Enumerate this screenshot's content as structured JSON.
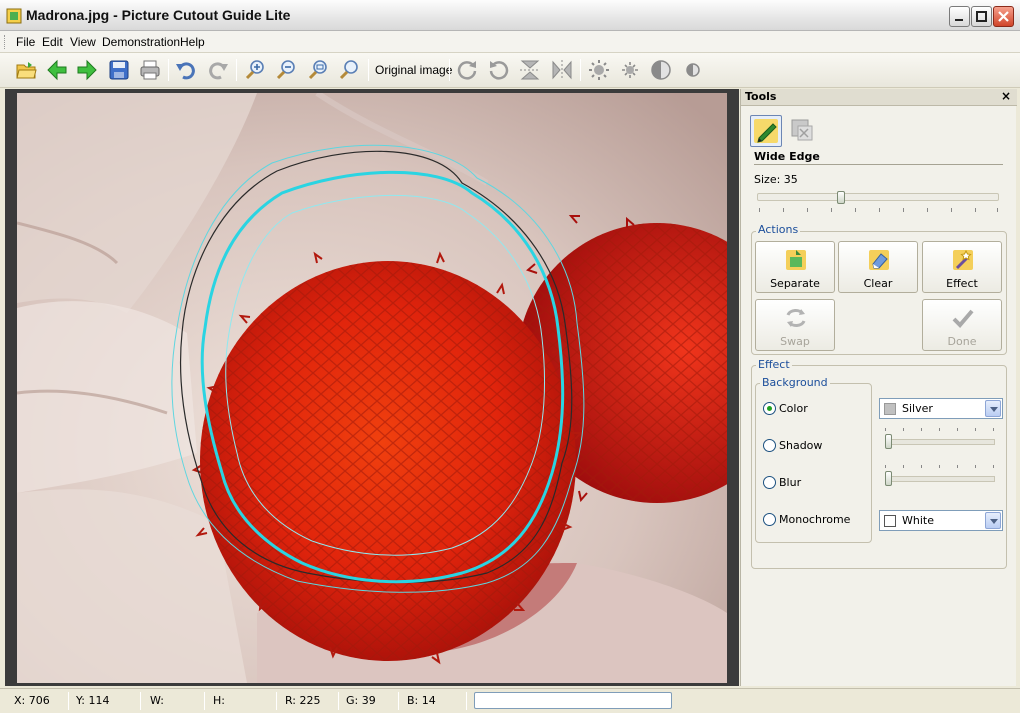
{
  "window": {
    "title": "Madrona.jpg - Picture Cutout Guide Lite"
  },
  "menu": {
    "items": [
      "File",
      "Edit",
      "View",
      "Demonstration",
      "Help"
    ]
  },
  "toolbar": {
    "original_image_label": "Original image"
  },
  "tools_panel": {
    "title": "Tools",
    "close_glyph": "×",
    "tool_name": "Wide Edge",
    "size_label": "Size: 35",
    "size_value": 35,
    "actions": {
      "group_label": "Actions",
      "separate": "Separate",
      "clear": "Clear",
      "effect": "Effect",
      "swap": "Swap",
      "done": "Done"
    },
    "effect": {
      "group_label": "Effect",
      "background_label": "Background",
      "options": [
        "Color",
        "Shadow",
        "Blur",
        "Monochrome"
      ],
      "selected": "Color",
      "color_value": "Silver",
      "color_swatch": "#c0c0c0",
      "monochrome_value": "White",
      "monochrome_swatch": "#ffffff"
    }
  },
  "status": {
    "x": "X: 706",
    "y": "Y: 114",
    "w": "W:",
    "h": "H:",
    "r": "R: 225",
    "g": "G: 39",
    "b": "B: 14"
  },
  "icons": [
    "app-icon",
    "open-folder-icon",
    "back-arrow-icon",
    "forward-arrow-icon",
    "save-icon",
    "print-icon",
    "undo-icon",
    "redo-icon",
    "zoom-in-icon",
    "zoom-out-icon",
    "zoom-fit-icon",
    "zoom-actual-icon",
    "rotate-cw-icon",
    "rotate-ccw-icon",
    "flip-vertical-icon",
    "flip-horizontal-icon",
    "brightness-up-icon",
    "brightness-down-icon",
    "contrast-up-icon",
    "contrast-down-icon",
    "pencil-tool-icon",
    "eraser-tool-icon"
  ]
}
